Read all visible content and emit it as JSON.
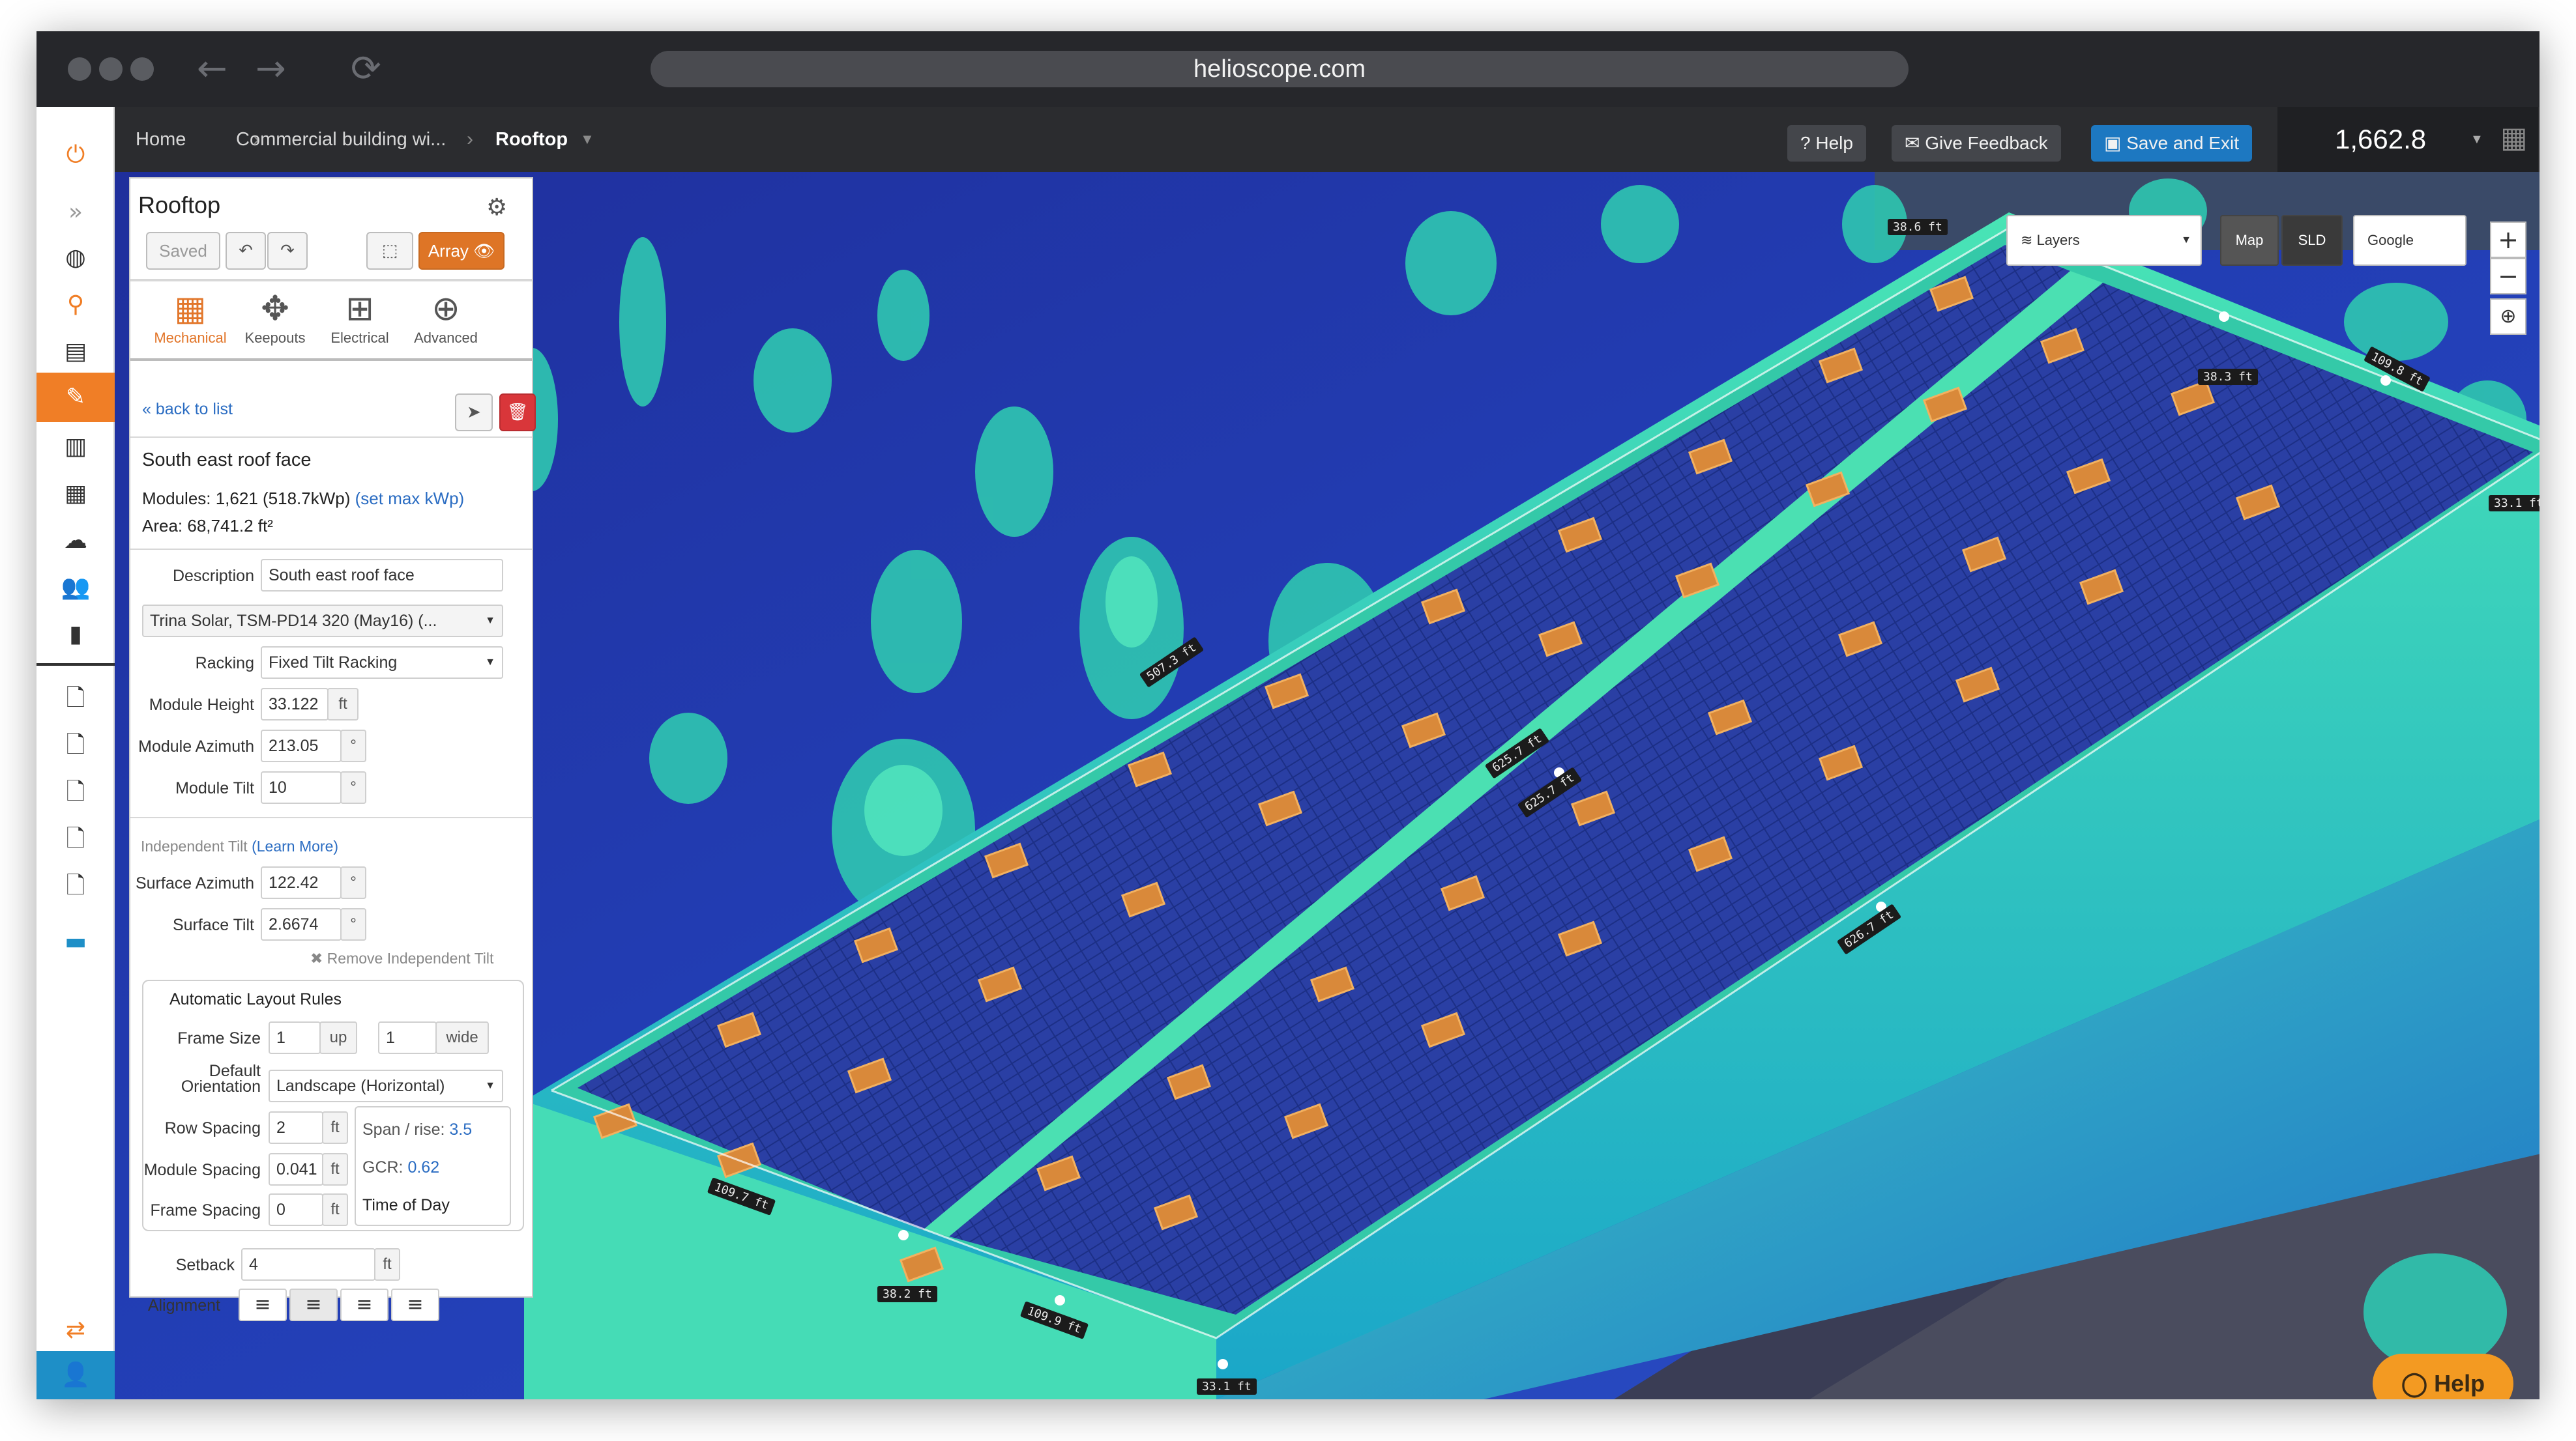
{
  "browser": {
    "url": "helioscope.com"
  },
  "topbar": {
    "breadcrumbs": [
      "Home",
      "Commercial building wi...",
      "Rooftop"
    ],
    "help_label": "Help",
    "feedback_label": "Give Feedback",
    "save_exit_label": "Save and Exit",
    "energy_value": "1,662.8"
  },
  "panel": {
    "title": "Rooftop",
    "saved_label": "Saved",
    "array_label": "Array",
    "tools": [
      {
        "label": "Mechanical",
        "icon": "grid-icon"
      },
      {
        "label": "Keepouts",
        "icon": "move-icon"
      },
      {
        "label": "Electrical",
        "icon": "sitemap-icon"
      },
      {
        "label": "Advanced",
        "icon": "plus-circle-icon"
      }
    ],
    "back_label": "« back to list",
    "field_segment_title": "South east roof face",
    "modules_text": "Modules: 1,621 (518.7kWp)",
    "set_max_label": "(set max kWp)",
    "area_text": "Area: 68,741.2 ft²",
    "description_label": "Description",
    "description_value": "South east roof face",
    "module_value": "Trina Solar, TSM-PD14 320 (May16) (...",
    "racking_label": "Racking",
    "racking_value": "Fixed Tilt Racking",
    "module_height_label": "Module Height",
    "module_height_value": "33.122",
    "module_height_unit": "ft",
    "module_azimuth_label": "Module Azimuth",
    "module_azimuth_value": "213.05",
    "module_tilt_label": "Module Tilt",
    "module_tilt_value": "10",
    "degree_unit": "°",
    "independent_tilt_label": "Independent Tilt",
    "learn_more_label": "(Learn More)",
    "surface_azimuth_label": "Surface Azimuth",
    "surface_azimuth_value": "122.42",
    "surface_tilt_label": "Surface Tilt",
    "surface_tilt_value": "2.6674",
    "remove_tilt_label": "✖ Remove Independent Tilt",
    "layout_rules_title": "Automatic Layout Rules",
    "frame_size_label": "Frame Size",
    "frame_up_value": "1",
    "frame_up_unit": "up",
    "frame_wide_value": "1",
    "frame_wide_unit": "wide",
    "orientation_label_1": "Default",
    "orientation_label_2": "Orientation",
    "orientation_value": "Landscape (Horizontal)",
    "row_spacing_label": "Row Spacing",
    "row_spacing_value": "2",
    "module_spacing_label": "Module Spacing",
    "module_spacing_value": "0.041",
    "frame_spacing_label": "Frame Spacing",
    "frame_spacing_value": "0",
    "ft_unit": "ft",
    "span_rise_label": "Span / rise:",
    "span_rise_value": "3.5",
    "gcr_label": "GCR:",
    "gcr_value": "0.62",
    "time_of_day_label": "Time of Day",
    "setback_label": "Setback",
    "setback_value": "4",
    "setback_unit": "ft",
    "alignment_label": "Alignment"
  },
  "map_controls": {
    "layers_label": "Layers",
    "map_label": "Map",
    "sld_label": "SLD",
    "google_label": "Google",
    "zoom_in": "+",
    "zoom_out": "−"
  },
  "dimension_labels": [
    "38.6 ft",
    "109.8 ft",
    "38.3 ft",
    "33.1 ft",
    "507.3 ft",
    "625.7 ft",
    "625.7 ft",
    "626.7 ft",
    "109.7 ft",
    "38.2 ft",
    "109.9 ft",
    "33.1 ft"
  ],
  "help_bubble": "Help",
  "colors": {
    "accent_orange": "#de7526",
    "save_blue": "#1d78c1",
    "lidar_cyan": "#3fe0b8",
    "lidar_blue": "#1e3fb0"
  }
}
